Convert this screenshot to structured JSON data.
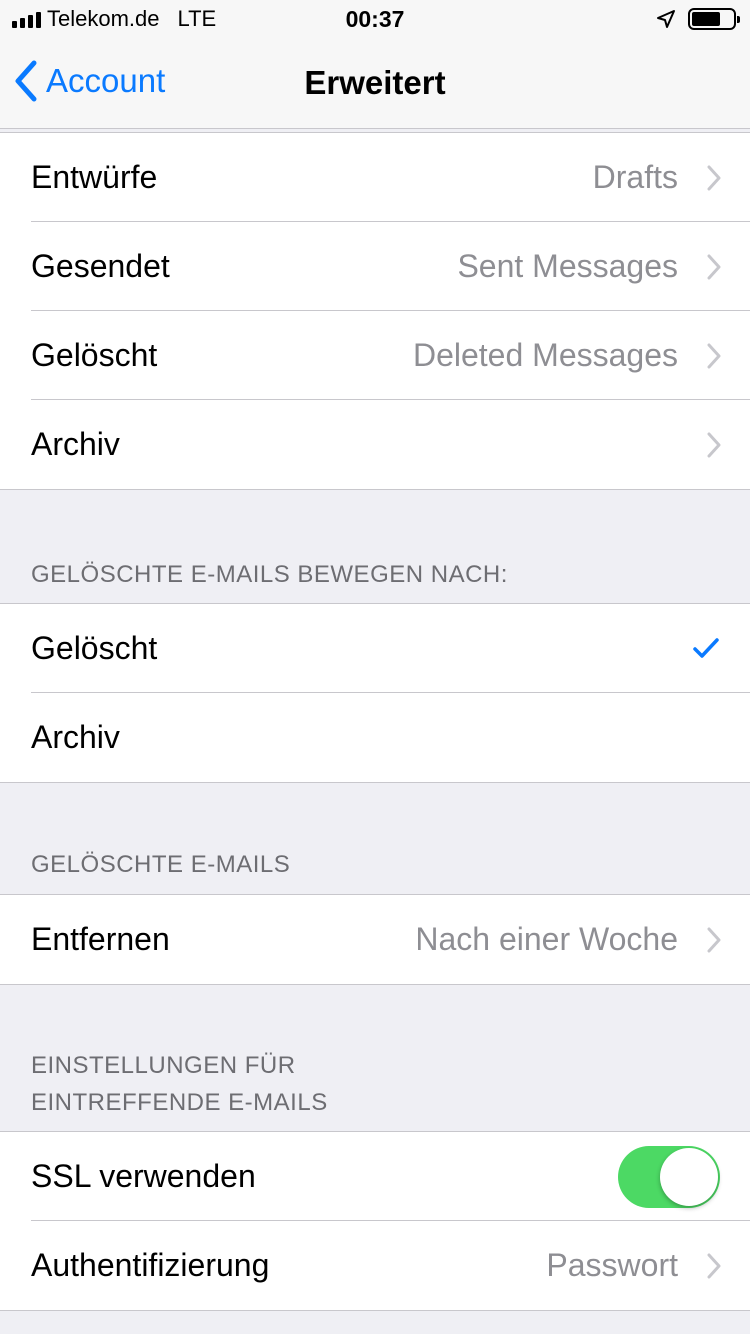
{
  "status_bar": {
    "carrier": "Telekom.de",
    "network": "LTE",
    "time": "00:37",
    "location_icon": "location-arrow-icon",
    "battery_icon": "battery-icon"
  },
  "nav": {
    "back_label": "Account",
    "title": "Erweitert",
    "accent_color": "#0a7aff"
  },
  "mailboxes": [
    {
      "label": "Entwürfe",
      "value": "Drafts"
    },
    {
      "label": "Gesendet",
      "value": "Sent Messages"
    },
    {
      "label": "Gelöscht",
      "value": "Deleted Messages"
    },
    {
      "label": "Archiv",
      "value": ""
    }
  ],
  "move_deleted": {
    "header": "GELÖSCHTE E-MAILS BEWEGEN NACH:",
    "options": [
      {
        "label": "Gelöscht",
        "selected": true
      },
      {
        "label": "Archiv",
        "selected": false
      }
    ]
  },
  "deleted_mails": {
    "header": "GELÖSCHTE E-MAILS",
    "remove_label": "Entfernen",
    "remove_value": "Nach einer Woche"
  },
  "incoming": {
    "header_line1": "EINSTELLUNGEN FÜR",
    "header_line2": "EINTREFFENDE E-MAILS",
    "ssl_label": "SSL verwenden",
    "ssl_on": true,
    "auth_label": "Authentifizierung",
    "auth_value": "Passwort",
    "toggle_color": "#4cd964"
  }
}
